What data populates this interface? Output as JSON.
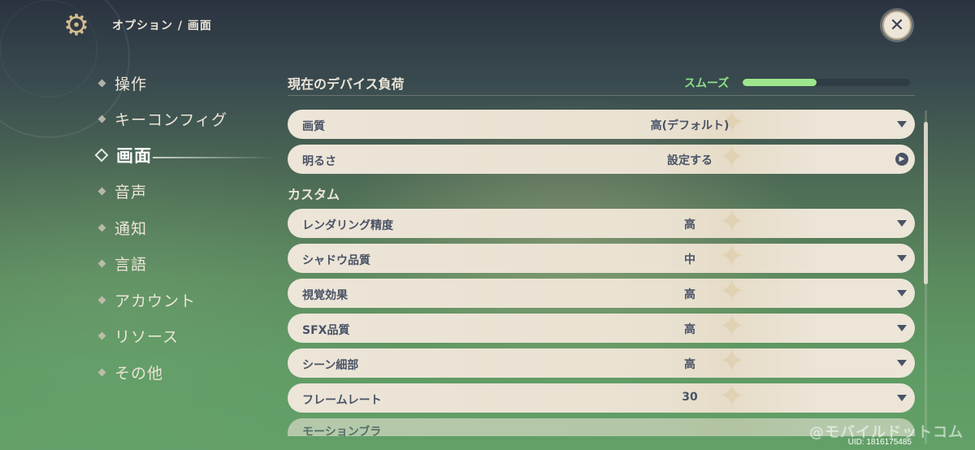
{
  "header": {
    "breadcrumb": "オプション / 画面",
    "gear_icon": "gear-icon",
    "close_icon": "close-icon",
    "close_glyph": "✕"
  },
  "sidebar": {
    "items": [
      {
        "label": "操作",
        "active": false
      },
      {
        "label": "キーコンフィグ",
        "active": false
      },
      {
        "label": "画面",
        "active": true
      },
      {
        "label": "音声",
        "active": false
      },
      {
        "label": "通知",
        "active": false
      },
      {
        "label": "言語",
        "active": false
      },
      {
        "label": "アカウント",
        "active": false
      },
      {
        "label": "リソース",
        "active": false
      },
      {
        "label": "その他",
        "active": false
      }
    ]
  },
  "device_load": {
    "title": "現在のデバイス負荷",
    "status": "スムーズ",
    "level": 0.44,
    "status_color": "#8fe08a"
  },
  "settings_top": [
    {
      "label": "画質",
      "value": "高(デフォルト)",
      "control": "dropdown"
    },
    {
      "label": "明るさ",
      "value": "設定する",
      "control": "go"
    }
  ],
  "custom": {
    "title": "カスタム",
    "rows": [
      {
        "label": "レンダリング精度",
        "value": "高"
      },
      {
        "label": "シャドウ品質",
        "value": "中"
      },
      {
        "label": "視覚効果",
        "value": "高"
      },
      {
        "label": "SFX品質",
        "value": "高"
      },
      {
        "label": "シーン細部",
        "value": "高"
      },
      {
        "label": "フレームレート",
        "value": "30"
      }
    ],
    "partial_row_label": "モーションブラ"
  },
  "footer": {
    "watermark": "@モバイルドットコム",
    "uid": "UID: 1816175485"
  },
  "colors": {
    "accent_gold": "#d3bc8e",
    "row_bg": "#ece5d8",
    "row_text": "#495366"
  }
}
